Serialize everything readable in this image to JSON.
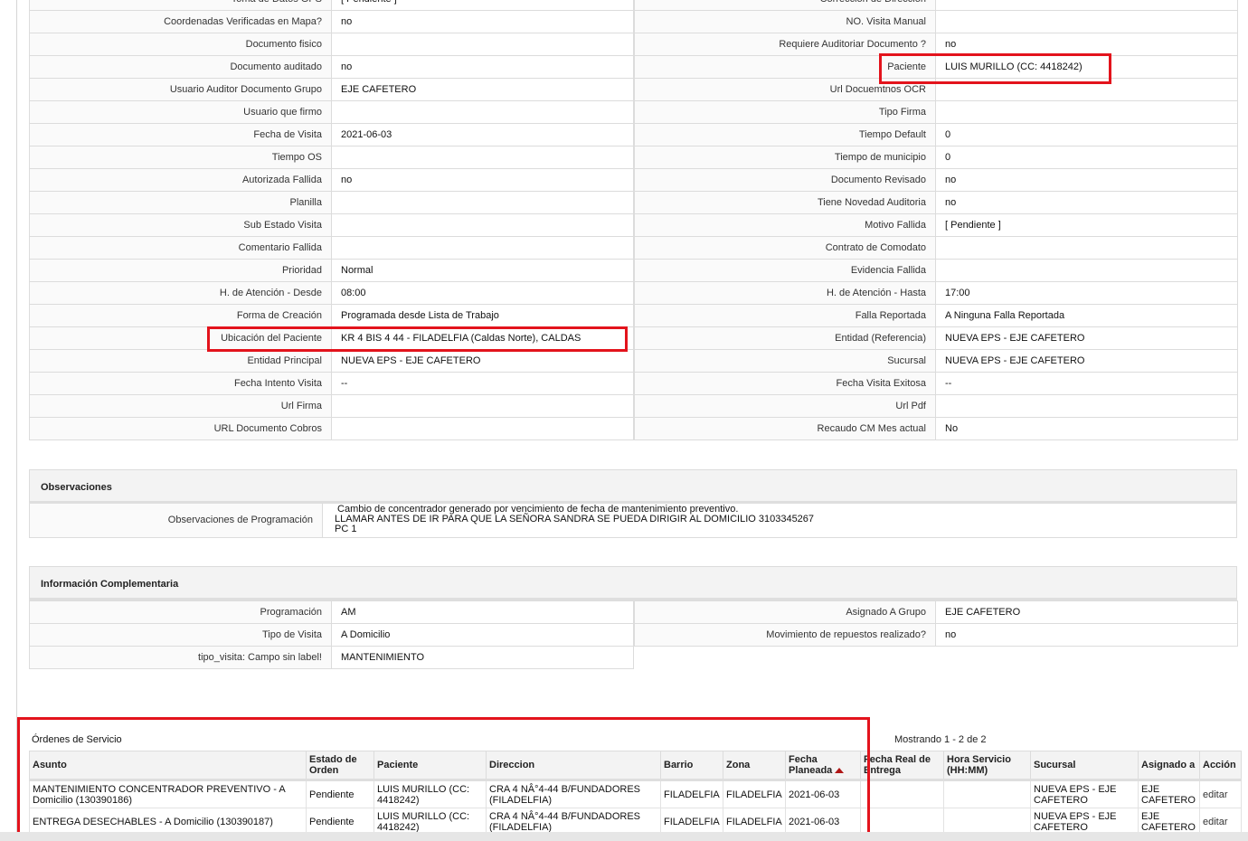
{
  "details": {
    "rows": [
      {
        "l1": "Toma de Datos GPS",
        "v1": "[ Pendiente ]",
        "l2": "Corrección de Dirección",
        "v2": ""
      },
      {
        "l1": "Coordenadas Verificadas en Mapa?",
        "v1": "no",
        "l2": "NO. Visita Manual",
        "v2": ""
      },
      {
        "l1": "Documento fisico",
        "v1": "",
        "l2": "Requiere Auditoriar Documento ?",
        "v2": "no"
      },
      {
        "l1": "Documento auditado",
        "v1": "no",
        "l2": "Paciente",
        "v2": "LUIS MURILLO (CC: 4418242)"
      },
      {
        "l1": "Usuario Auditor Documento Grupo",
        "v1": "EJE CAFETERO",
        "l2": "Url Docuemtnos OCR",
        "v2": ""
      },
      {
        "l1": "Usuario que firmo",
        "v1": "",
        "l2": "Tipo Firma",
        "v2": ""
      },
      {
        "l1": "Fecha de Visita",
        "v1": "2021-06-03",
        "l2": "Tiempo Default",
        "v2": "0"
      },
      {
        "l1": "Tiempo OS",
        "v1": "",
        "l2": "Tiempo de municipio",
        "v2": "0"
      },
      {
        "l1": "Autorizada Fallida",
        "v1": "no",
        "l2": "Documento Revisado",
        "v2": "no"
      },
      {
        "l1": "Planilla",
        "v1": "",
        "l2": "Tiene Novedad Auditoria",
        "v2": "no"
      },
      {
        "l1": "Sub Estado Visita",
        "v1": "",
        "l2": "Motivo Fallida",
        "v2": "[ Pendiente ]"
      },
      {
        "l1": "Comentario Fallida",
        "v1": "",
        "l2": "Contrato de Comodato",
        "v2": ""
      },
      {
        "l1": "Prioridad",
        "v1": "Normal",
        "l2": "Evidencia Fallida",
        "v2": ""
      },
      {
        "l1": "H. de Atención - Desde",
        "v1": "08:00",
        "l2": "H. de Atención - Hasta",
        "v2": "17:00"
      },
      {
        "l1": "Forma de Creación",
        "v1": "Programada desde Lista de Trabajo",
        "l2": "Falla Reportada",
        "v2": "A Ninguna Falla Reportada"
      },
      {
        "l1": "Ubicación del Paciente",
        "v1": "KR 4 BIS 4 44 - FILADELFIA (Caldas Norte), CALDAS",
        "l2": "Entidad (Referencia)",
        "v2": "NUEVA EPS - EJE CAFETERO"
      },
      {
        "l1": "Entidad Principal",
        "v1": "NUEVA EPS - EJE CAFETERO",
        "l2": "Sucursal",
        "v2": "NUEVA EPS - EJE CAFETERO"
      },
      {
        "l1": "Fecha Intento Visita",
        "v1": "--",
        "l2": "Fecha Visita Exitosa",
        "v2": "--"
      },
      {
        "l1": "Url Firma",
        "v1": "",
        "l2": "Url Pdf",
        "v2": ""
      },
      {
        "l1": "URL Documento Cobros",
        "v1": "",
        "l2": "Recaudo CM Mes actual",
        "v2": "No"
      }
    ]
  },
  "observaciones": {
    "title": "Observaciones",
    "label": "Observaciones de Programación",
    "text": " Cambio de concentrador generado por vencimiento de fecha de mantenimiento preventivo.\nLLAMAR ANTES DE IR PARA QUE LA SEÑORA SANDRA SE PUEDA DIRIGIR AL DOMICILIO 3103345267\nPC 1"
  },
  "complementaria": {
    "title": "Información Complementaria",
    "rows": [
      {
        "l1": "Programación",
        "v1": "AM",
        "l2": "Asignado A Grupo",
        "v2": "EJE CAFETERO"
      },
      {
        "l1": "Tipo de Visita",
        "v1": "A Domicilio",
        "l2": "Movimiento de repuestos realizado?",
        "v2": "no"
      },
      {
        "l1": "tipo_visita: Campo sin label!",
        "v1": "MANTENIMIENTO"
      }
    ]
  },
  "orders": {
    "title": "Órdenes de Servicio",
    "count_text": "Mostrando 1 - 2 de 2",
    "columns": [
      "Asunto",
      "Estado de Orden",
      "Paciente",
      "Direccion",
      "Barrio",
      "Zona",
      "Fecha Planeada",
      "Fecha Real de Entrega",
      "Hora Servicio (HH:MM)",
      "Sucursal",
      "Asignado a",
      "Acción"
    ],
    "rows": [
      {
        "asunto": "MANTENIMIENTO CONCENTRADOR PREVENTIVO - A Domicilio (130390186)",
        "estado": "Pendiente",
        "paciente": "LUIS MURILLO (CC: 4418242)",
        "direccion": "CRA 4 NÂ°4-44 B/FUNDADORES (FILADELFIA)",
        "barrio": "FILADELFIA",
        "zona": "FILADELFIA",
        "fecha_planeada": "2021-06-03",
        "fecha_real": "",
        "hora": "",
        "sucursal": "NUEVA EPS - EJE CAFETERO",
        "asignado": "EJE CAFETERO",
        "accion": "editar"
      },
      {
        "asunto": "ENTREGA DESECHABLES - A Domicilio (130390187)",
        "estado": "Pendiente",
        "paciente": "LUIS MURILLO (CC: 4418242)",
        "direccion": "CRA 4 NÂ°4-44 B/FUNDADORES (FILADELFIA)",
        "barrio": "FILADELFIA",
        "zona": "FILADELFIA",
        "fecha_planeada": "2021-06-03",
        "fecha_real": "",
        "hora": "",
        "sucursal": "NUEVA EPS - EJE CAFETERO",
        "asignado": "EJE CAFETERO",
        "accion": "editar"
      }
    ]
  },
  "colors": {
    "highlight": "#e3131c",
    "sort_arrow": "#b01616"
  }
}
